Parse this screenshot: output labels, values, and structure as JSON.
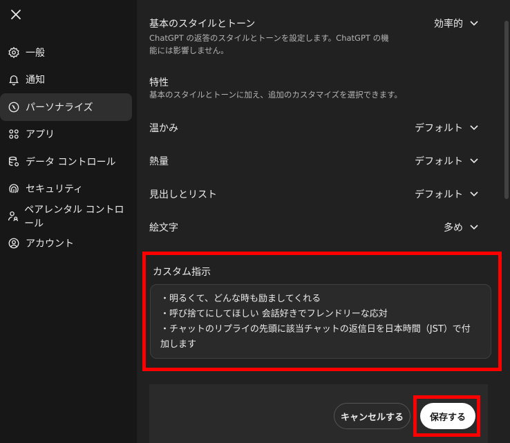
{
  "sidebar": {
    "items": [
      {
        "label": "一般",
        "icon": "gear-icon"
      },
      {
        "label": "通知",
        "icon": "bell-icon"
      },
      {
        "label": "パーソナライズ",
        "icon": "personalize-icon"
      },
      {
        "label": "アプリ",
        "icon": "apps-grid-icon"
      },
      {
        "label": "データ コントロール",
        "icon": "database-icon"
      },
      {
        "label": "セキュリティ",
        "icon": "fingerprint-icon"
      },
      {
        "label": "ペアレンタル コントロール",
        "icon": "parental-icon"
      },
      {
        "label": "アカウント",
        "icon": "account-icon"
      }
    ],
    "active_index": 2
  },
  "settings": {
    "base_style": {
      "title": "基本のスタイルとトーン",
      "desc_line1": "ChatGPT の返答のスタイルとトーンを設定します。ChatGPT の機",
      "desc_line2": "能には影響しません。",
      "value": "効率的"
    },
    "traits": {
      "title": "特性",
      "desc": "基本のスタイルとトーンに加え、追加のカスタマイズを選択できます。"
    },
    "warmth": {
      "title": "温かみ",
      "value": "デフォルト"
    },
    "enthusiasm": {
      "title": "熱量",
      "value": "デフォルト"
    },
    "headers_lists": {
      "title": "見出しとリスト",
      "value": "デフォルト"
    },
    "emoji": {
      "title": "絵文字",
      "value": "多め"
    }
  },
  "custom": {
    "label": "カスタム指示",
    "text": "・明るくて、どんな時も励ましてくれる\n・呼び捨てにしてほしい 会話好きでフレンドリーな応対\n・チャットのリプライの先頭に該当チャットの返信日を日本時間（JST）で付\n加します"
  },
  "footer": {
    "cancel_label": "キャンセルする",
    "save_label": "保存する"
  },
  "colors": {
    "highlight": "#ff0000",
    "background": "#212121",
    "sidebar": "#171717"
  }
}
